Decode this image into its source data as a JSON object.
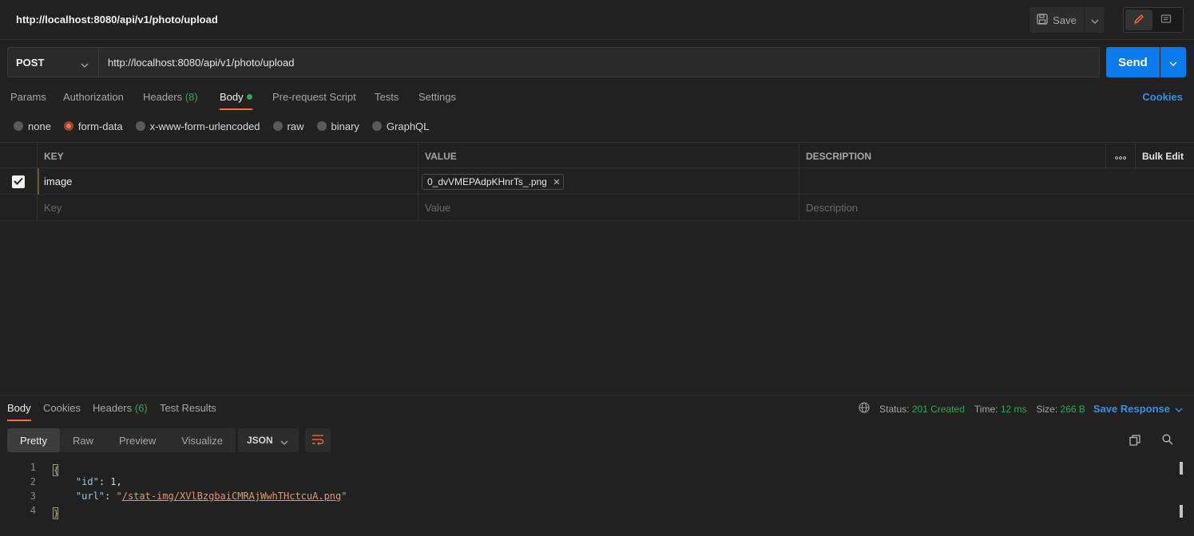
{
  "titlebar": {
    "title": "http://localhost:8080/api/v1/photo/upload",
    "save_label": "Save"
  },
  "request": {
    "method": "POST",
    "url": "http://localhost:8080/api/v1/photo/upload",
    "send_label": "Send"
  },
  "req_tabs": {
    "params": "Params",
    "authorization": "Authorization",
    "headers": "Headers",
    "headers_count": "(8)",
    "body": "Body",
    "prerequest": "Pre-request Script",
    "tests": "Tests",
    "settings": "Settings",
    "cookies": "Cookies"
  },
  "body_types": {
    "none": "none",
    "form_data": "form-data",
    "urlencoded": "x-www-form-urlencoded",
    "raw": "raw",
    "binary": "binary",
    "graphql": "GraphQL",
    "selected": "form-data"
  },
  "kv_table": {
    "headers": {
      "key": "KEY",
      "value": "VALUE",
      "description": "DESCRIPTION",
      "bulk_edit": "Bulk Edit"
    },
    "rows": [
      {
        "key": "image",
        "value": "0_dvVMEPAdpKHnrTs_.png",
        "description": ""
      }
    ],
    "placeholders": {
      "key": "Key",
      "value": "Value",
      "description": "Description"
    }
  },
  "response": {
    "tabs": {
      "body": "Body",
      "cookies": "Cookies",
      "headers": "Headers",
      "headers_count": "(6)",
      "test_results": "Test Results"
    },
    "status_label": "Status:",
    "status_value": "201 Created",
    "time_label": "Time:",
    "time_value": "12 ms",
    "size_label": "Size:",
    "size_value": "266 B",
    "save_response": "Save Response",
    "views": {
      "pretty": "Pretty",
      "raw": "Raw",
      "preview": "Preview",
      "visualize": "Visualize"
    },
    "format": "JSON",
    "code": {
      "line_numbers": [
        "1",
        "2",
        "3",
        "4"
      ],
      "open_brace": "{",
      "close_brace": "}",
      "id_key": "\"id\"",
      "id_value": "1",
      "url_key": "\"url\"",
      "url_value": "/stat-img/XVlBzgbaiCMRAjWwhTHctcuA.png"
    }
  },
  "colors": {
    "accent": "#ff6c37",
    "primary_button": "#097bed",
    "status_green": "#2fa84f",
    "link_blue": "#3d8fe0"
  }
}
